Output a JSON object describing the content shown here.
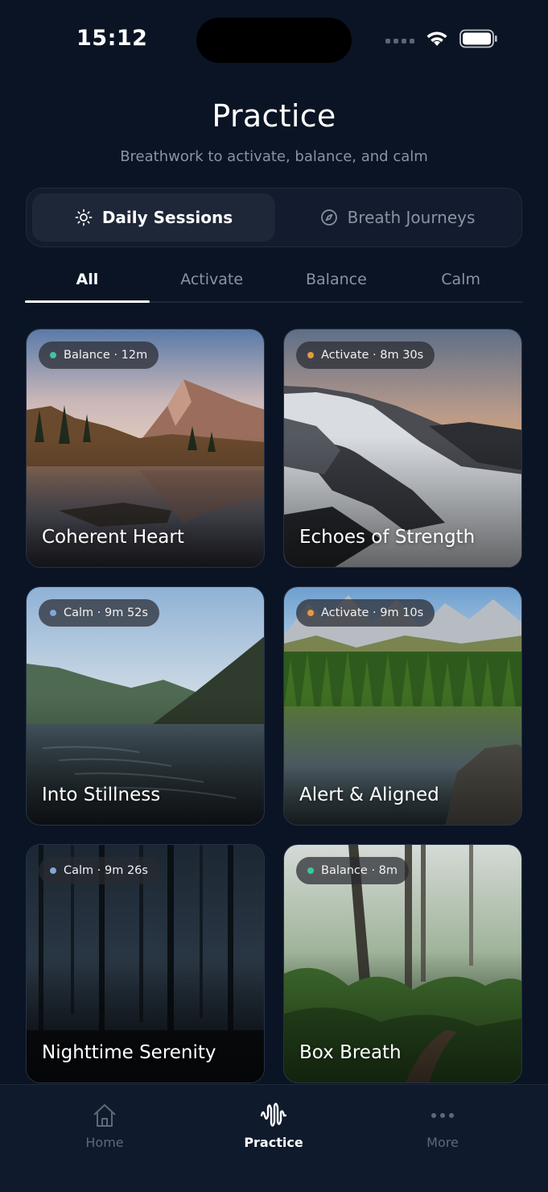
{
  "status_bar": {
    "time": "15:12"
  },
  "header": {
    "title": "Practice",
    "subtitle": "Breathwork to activate, balance, and calm"
  },
  "segmented": {
    "active": {
      "label": "Daily Sessions",
      "icon": "sun-icon"
    },
    "inactive": {
      "label": "Breath Journeys",
      "icon": "compass-icon"
    }
  },
  "filters": [
    "All",
    "Activate",
    "Balance",
    "Calm"
  ],
  "filter_selected": "All",
  "colors": {
    "balance": "#3fc3a3",
    "activate": "#e59a3d",
    "calm": "#7fa7d8",
    "background": "#0b1424"
  },
  "sessions": [
    {
      "title": "Coherent Heart",
      "badge": "Balance · 12m",
      "category": "balance"
    },
    {
      "title": "Echoes of Strength",
      "badge": "Activate · 8m 30s",
      "category": "activate"
    },
    {
      "title": "Into Stillness",
      "badge": "Calm · 9m 52s",
      "category": "calm"
    },
    {
      "title": "Alert & Aligned",
      "badge": "Activate · 9m 10s",
      "category": "activate"
    },
    {
      "title": "Nighttime Serenity",
      "badge": "Calm · 9m 26s",
      "category": "calm"
    },
    {
      "title": "Box Breath",
      "badge": "Balance · 8m",
      "category": "balance"
    }
  ],
  "bottom_nav": [
    {
      "label": "Home",
      "icon": "home-icon"
    },
    {
      "label": "Practice",
      "icon": "waveform-icon"
    },
    {
      "label": "More",
      "icon": "more-dots-icon"
    }
  ]
}
